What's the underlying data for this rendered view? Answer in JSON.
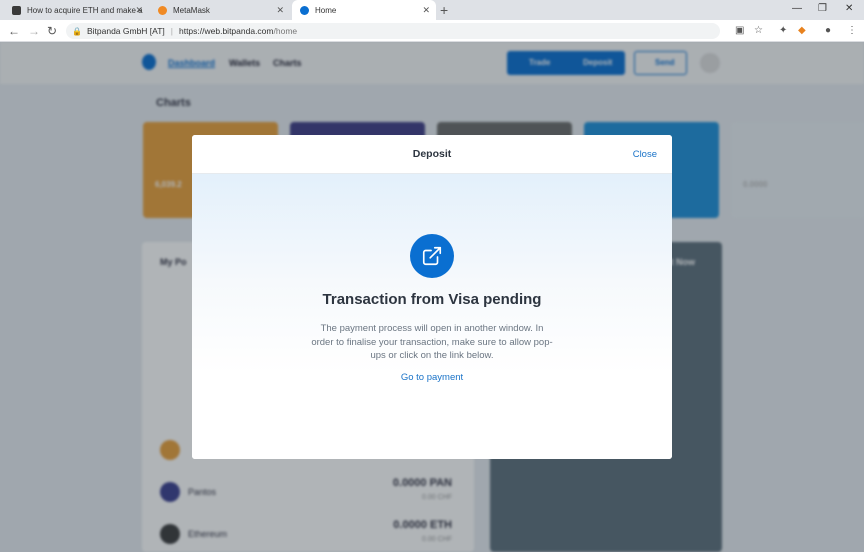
{
  "browser": {
    "tabs": [
      {
        "title": "How to acquire ETH and make a",
        "favicon": "m-logo-icon"
      },
      {
        "title": "MetaMask",
        "favicon": "metamask-fox-icon"
      },
      {
        "title": "Home",
        "favicon": "bitpanda-icon"
      }
    ],
    "new_tab": "+",
    "site_identity": "Bitpanda GmbH [AT]",
    "url_host": "https://web.bitpanda.com",
    "url_path": "/home"
  },
  "page": {
    "nav": [
      "Dashboard",
      "Wallets",
      "Charts"
    ],
    "trade_label": "Trade",
    "deposit_label": "Deposit",
    "send_label": "Send",
    "section_title": "Charts",
    "portfolio_title": "My Po",
    "right_panel_title": "ht Now",
    "coins": [
      {
        "name": "Pantos",
        "value": "0.0000 PAN",
        "sub": "0.00 CHF",
        "color": "#3b3f8f"
      },
      {
        "name": "Ethereum",
        "value": "0.0000 ETH",
        "sub": "0.00 CHF",
        "color": "#3c3c3d"
      }
    ],
    "card_values": [
      "6,039.2",
      "",
      "",
      "",
      "0.0000"
    ],
    "card_colors": [
      "#e9a03b",
      "#3f3d86",
      "#6b6b6b",
      "#1e90d9",
      "#e8eef3"
    ]
  },
  "modal": {
    "title": "Deposit",
    "close_label": "Close",
    "icon": "external-link-icon",
    "heading": "Transaction from Visa pending",
    "description": "The payment process will open in another window. In order to finalise your transaction, make sure to allow pop-ups or click on the link below.",
    "link_label": "Go to payment",
    "accent": "#0a6fd1"
  }
}
